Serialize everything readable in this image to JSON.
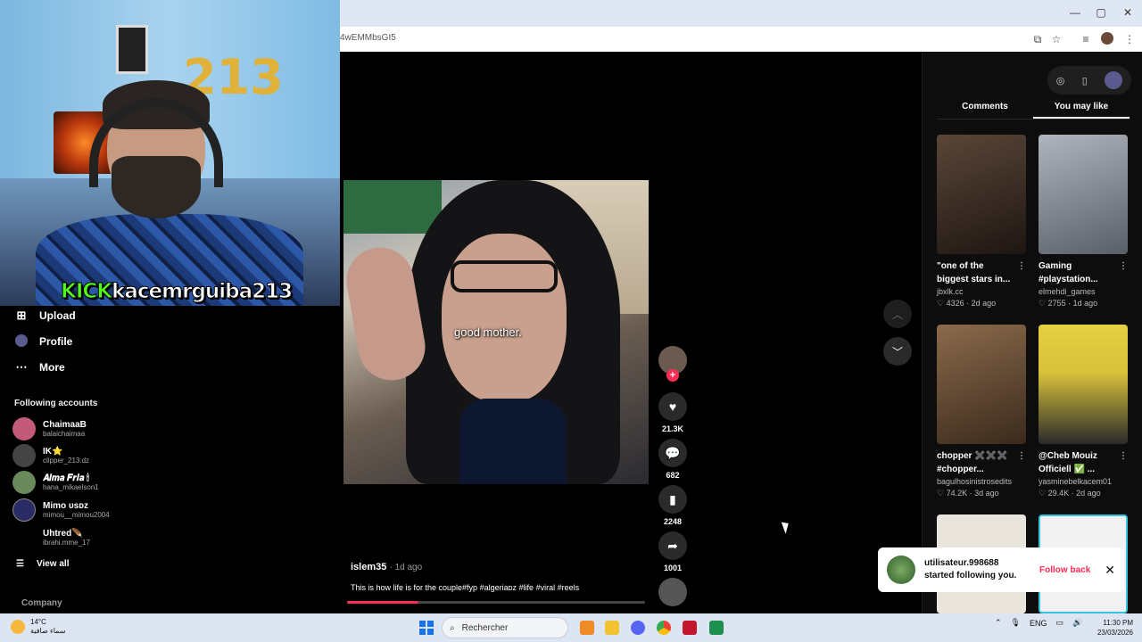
{
  "browser": {
    "url": "4wEMMbsGI5",
    "controls": {
      "minimize": "—",
      "maximize": "▢",
      "close": "✕"
    },
    "toolbar_icons": [
      "cast-icon",
      "star-icon",
      "media-icon",
      "profile-avatar",
      "menu-icon"
    ]
  },
  "webcam": {
    "balloon_text": "213",
    "kick_label": "KICK",
    "username": "kacemrguiba213"
  },
  "sidebar": {
    "nav": [
      {
        "label": "Upload",
        "icon": "upload-icon"
      },
      {
        "label": "Profile",
        "icon": "profile-icon"
      },
      {
        "label": "More",
        "icon": "more-icon"
      }
    ],
    "following_title": "Following accounts",
    "accounts": [
      {
        "name": "ChaimaaB",
        "handle": "balaichaimaa",
        "color": "#c45a7a"
      },
      {
        "name": "IK⭐",
        "handle": "clipper_213.dz",
        "color": "#444444"
      },
      {
        "name": "𝑨𝒍𝒎𝒂 𝑭𝒓𝒊𝒂 🕯",
        "handle": "hana_mikaelson1",
        "color": "#6b8a5c"
      },
      {
        "name": "Mimo ᴜsᴅᴢ",
        "handle": "mimou__mimou2004",
        "color": "#2b2b66"
      },
      {
        "name": "Uhtred🪶",
        "handle": "ibrahi.mme_17",
        "color": "#000000"
      }
    ],
    "view_all": "View all",
    "company": "Company"
  },
  "video": {
    "caption": "good mother.",
    "progress": 0.24,
    "author": "islem35",
    "ago": "· 1d ago",
    "description": "This is how life is for the couple#fyp #algeriaᴅᴢ #life #viral #reels"
  },
  "actions": {
    "likes": "21.3K",
    "comments": "682",
    "saves": "2248",
    "shares": "1001"
  },
  "right_panel": {
    "tabs": [
      "Comments",
      "You may like"
    ],
    "active_tab": "You may like",
    "cards": [
      {
        "title": "\"one of the biggest stars in...",
        "user": "jbxlk.cc",
        "likes": "4326",
        "ago": "2d ago",
        "color": "#3a2a22"
      },
      {
        "title": "Gaming #playstation...",
        "user": "elmehdi_games",
        "likes": "2755",
        "ago": "1d ago",
        "color": "#8a8f98"
      },
      {
        "title": "chopper ✖️✖️✖️ #chopper...",
        "user": "bagulhosinistrosedits",
        "likes": "74.2K",
        "ago": "3d ago",
        "color": "#6b4a32"
      },
      {
        "title": "@Cheb Mouiz Officiell ✅ ...",
        "user": "yasminebelkacem01",
        "likes": "29.4K",
        "ago": "2d ago",
        "color": "#d6c23a"
      },
      {
        "title": "",
        "user": "",
        "likes": "",
        "ago": "",
        "color": "#e9e4dc"
      },
      {
        "title": "",
        "user": "",
        "likes": "",
        "ago": "",
        "color": "#f2f2f2"
      }
    ]
  },
  "notification": {
    "user": "utilisateur.998688",
    "text": "started following you.",
    "action": "Follow back"
  },
  "taskbar": {
    "weather_temp": "14°C",
    "weather_desc": "سماء صافية",
    "search_placeholder": "Rechercher",
    "lang": "ENG",
    "time": "11:30 PM",
    "date": "23/03/2026"
  }
}
